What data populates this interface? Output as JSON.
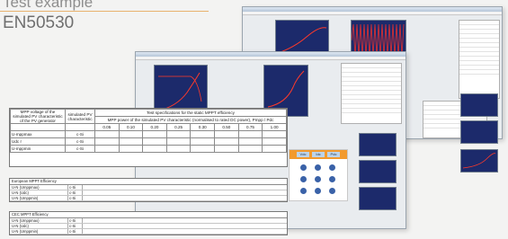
{
  "header": {
    "title": "Test example",
    "standard": "EN50530"
  },
  "colors": {
    "accent_line": "#e9b26e",
    "plot_bg": "#1c2a6b",
    "curve": "#ff3a2a",
    "sine": "#e23030",
    "dialog_accent": "#f29a2e"
  },
  "table": {
    "title": "Test specifications for the static MPPT efficiency",
    "col_head_1": "MPP voltage of the simulated PV characteristic of the PV generator",
    "col_head_2": "simulated PV characteristic",
    "col_head_3": "MPP power of the simulated PV characteristic (normalised to rated DC power), Pmpp / Pdc",
    "levels": [
      "0.05",
      "0.10",
      "0.20",
      "0.25",
      "0.30",
      "0.50",
      "0.75",
      "1.00"
    ],
    "rows": [
      {
        "label": "U-mppmax",
        "type": "c-Si"
      },
      {
        "label": "Udc r",
        "type": "c-Si"
      },
      {
        "label": "U-mppmin",
        "type": "c-Si"
      }
    ]
  },
  "eu_group": {
    "title": "European MPPT Efficiency",
    "rows": [
      "U-N (Umppmax)",
      "U-N (Udc)",
      "U-N (Umppmin)"
    ],
    "values": [
      "c-Si",
      "c-Si",
      "c-Si"
    ]
  },
  "cec_group": {
    "title": "CEC MPPT Efficiency",
    "rows": [
      "U-N (Umppmax)",
      "U-N (Udc)",
      "U-N (Umppmin)"
    ],
    "values": [
      "c-Si",
      "c-Si",
      "c-Si"
    ]
  },
  "dialog": {
    "tabs": [
      "Vdc",
      "Idc",
      "Pdc"
    ]
  }
}
